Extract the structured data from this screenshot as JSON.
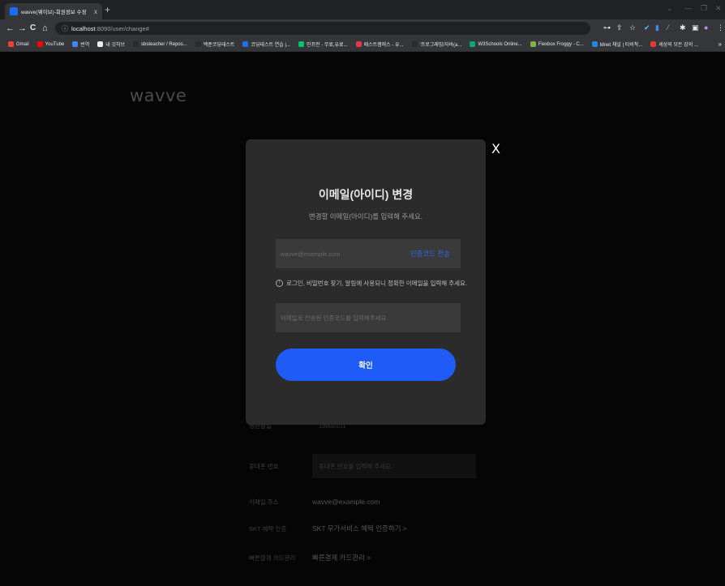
{
  "browser": {
    "tab_title": "wavve(웨이브)-회원정보 수정",
    "tab_close": "x",
    "new_tab": "+",
    "window_controls": [
      "⌄",
      "—",
      "❐",
      "✕"
    ],
    "url_host": "localhost",
    "url_path": ":8090/user/change#",
    "nav": {
      "back": "←",
      "forward": "→",
      "reload": "C",
      "home": "⌂"
    },
    "right_icons": [
      "⊶",
      "⇪",
      "☆",
      "✔",
      "▮",
      "⁄",
      "✱",
      "▣",
      "●",
      "⋮"
    ],
    "bookmarks": [
      {
        "label": "Gmail",
        "color": "#ea4335"
      },
      {
        "label": "YouTube",
        "color": "#ff0000"
      },
      {
        "label": "번역",
        "color": "#4285f4"
      },
      {
        "label": "내 깃허브",
        "color": "#e8eaed"
      },
      {
        "label": "sbsteacher / Repos...",
        "color": "#2b2b2b"
      },
      {
        "label": "백준코딩테스트",
        "color": "#2b2b2b"
      },
      {
        "label": "코딩테스트 연습 |...",
        "color": "#1a73e8"
      },
      {
        "label": "인프런 - 무료,유료...",
        "color": "#00c471"
      },
      {
        "label": "패스트캠퍼스 - 유...",
        "color": "#e8344e"
      },
      {
        "label": "'프로그래밍/자바(a...",
        "color": "#2b2b2b"
      },
      {
        "label": "W3Schools Online...",
        "color": "#04aa6d"
      },
      {
        "label": "Flexbox Froggy - C...",
        "color": "#7cb342"
      },
      {
        "label": "Mnet 채널 | 티비착...",
        "color": "#1e88e5"
      },
      {
        "label": "세상의 모든 강의 ...",
        "color": "#e53935"
      }
    ],
    "bookmarks_more": "»"
  },
  "page": {
    "logo": "wavve",
    "background_rows": [
      {
        "label": "생년월일",
        "value": "19900101",
        "is_field": false
      },
      {
        "label": "휴대폰 번호",
        "value": "휴대폰 번호를 입력해 주세요.",
        "is_field": true
      },
      {
        "label": "이메일 주소",
        "value": "wavve@example.com",
        "is_field": false
      },
      {
        "label": "SKT 혜택 인증",
        "value": "SKT 무가서비스 혜택 인증하기 >",
        "is_field": false
      },
      {
        "label": "빠른결제 카드관리",
        "value": "빠른결제 카드관리 >",
        "is_field": false
      }
    ]
  },
  "modal": {
    "close": "X",
    "title": "이메일(아이디) 변경",
    "subtitle": "변경할 이메일(아이디)를 입력해 주세요.",
    "email_placeholder": "wavve@example.com",
    "send_code": "인증코드 전송",
    "notice": "로그인, 비밀번호 찾기, 알림에 사용되니 정확한 이메일을 입력해 주세요.",
    "code_placeholder": "이메일로 전송된 인증코드를 입력해주세요.",
    "confirm": "확인"
  }
}
